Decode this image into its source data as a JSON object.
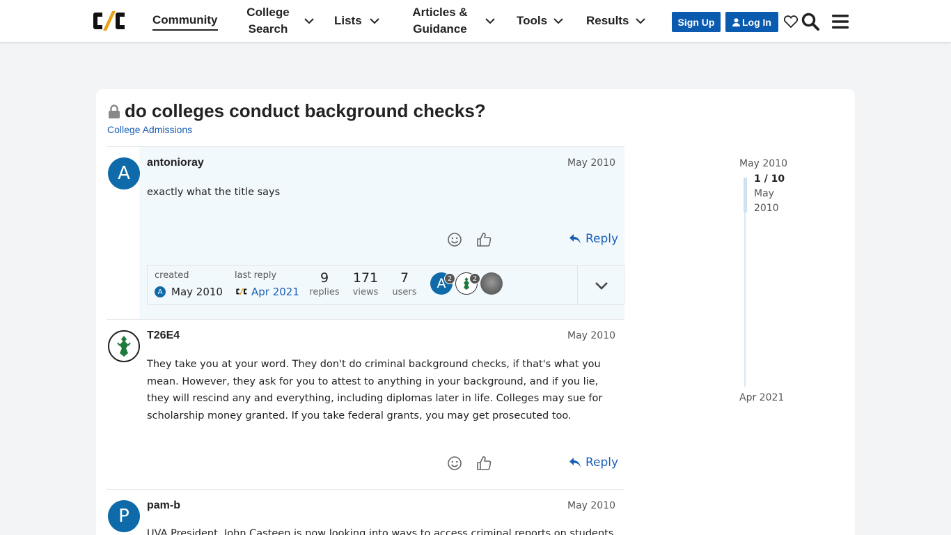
{
  "header": {
    "nav": [
      {
        "label": "Community",
        "active": true
      },
      {
        "label": "College\nSearch"
      },
      {
        "label": "Lists"
      },
      {
        "label": "Articles &\nGuidance"
      },
      {
        "label": "Tools"
      },
      {
        "label": "Results"
      }
    ],
    "signup_label": "Sign Up",
    "login_label": "Log In"
  },
  "topic": {
    "title": "do colleges conduct background checks?",
    "category": "College Admissions"
  },
  "posts": [
    {
      "avatar_letter": "A",
      "avatar_color": "#0e6aa8",
      "username": "antonioray",
      "date": "May 2010",
      "text": "exactly what the title says",
      "reply_label": "Reply"
    },
    {
      "avatar_letter": "",
      "username": "T26E4",
      "date": "May 2010",
      "text": "They take you at your word. They don't do criminal background checks, if that's what you mean. However, they ask for you to attest to anything in your background, and if you lie, they will rescind any and everything, including diplomas later in life. Colleges may sue for scholarship money granted. If you take federal grants, you may get prosecuted too.",
      "reply_label": "Reply"
    },
    {
      "avatar_letter": "P",
      "avatar_color": "#0e6aa8",
      "username": "pam-b",
      "date": "May 2010",
      "text": "UVA President, John Casteen is now looking into ways to access criminal reports on students"
    }
  ],
  "topic_map": {
    "created_label": "created",
    "created_avatar": "A",
    "created_date": "May 2010",
    "last_reply_label": "last reply",
    "last_reply_date": "Apr 2021",
    "replies_count": "9",
    "replies_label": "replies",
    "views_count": "171",
    "views_label": "views",
    "users_count": "7",
    "users_label": "users",
    "participant_1_letter": "A",
    "participant_1_badge": "2",
    "participant_2_badge": "2"
  },
  "timeline": {
    "start": "May 2010",
    "position": "1 / 10",
    "position_date_1": "May",
    "position_date_2": "2010",
    "end": "Apr 2021"
  },
  "colors": {
    "accent": "#1a5fb4",
    "button": "#0a5bb0",
    "highlight": "#f2f9fd"
  }
}
